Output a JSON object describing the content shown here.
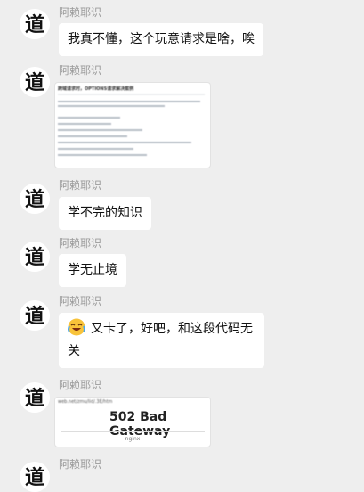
{
  "messages": [
    {
      "sender": "阿赖耶识",
      "text": "我真不懂，这个玩意请求是啥，唉"
    },
    {
      "sender": "阿赖耶识",
      "image": {
        "title": "跨域请求时，OPTIONS请求解决案例"
      }
    },
    {
      "sender": "阿赖耶识",
      "text": "学不完的知识"
    },
    {
      "sender": "阿赖耶识",
      "text": "学无止境"
    },
    {
      "sender": "阿赖耶识",
      "emoji": "crying-laughing-emoji",
      "text": "又卡了，好吧，和这段代码无关"
    },
    {
      "sender": "阿赖耶识",
      "image": {
        "url": "web.net/zmu/lid/.3E/htm",
        "heading": "502 Bad Gateway",
        "footer": "nginx"
      }
    },
    {
      "sender": "阿赖耶识"
    }
  ]
}
